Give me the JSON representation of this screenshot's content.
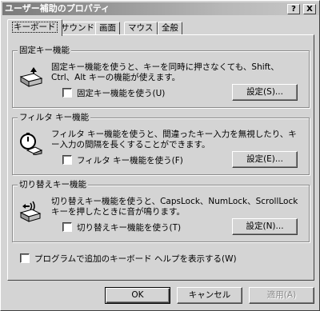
{
  "window": {
    "title": "ユーザー補助のプロパティ",
    "help_btn": "?",
    "close_btn": "X"
  },
  "tabs": [
    {
      "label": "キーボード",
      "active": true
    },
    {
      "label": "サウンド",
      "active": false
    },
    {
      "label": "画面",
      "active": false
    },
    {
      "label": "マウス",
      "active": false
    },
    {
      "label": "全般",
      "active": false
    }
  ],
  "groups": {
    "sticky": {
      "title": "固定キー機能",
      "desc": "固定キー機能を使うと、キーを同時に押さなくても、Shift、Ctrl、Alt キーの機能が使えます。",
      "check_label": "固定キー機能を使う(U)",
      "settings_label": "設定(S)...",
      "icon": "sticky-keys-icon"
    },
    "filter": {
      "title": "フィルタ キー機能",
      "desc": "フィルタ キー機能を使うと、間違ったキー入力を無視したり、キー入力の間隔を長くすることができます。",
      "check_label": "フィルタ キー機能を使う(F)",
      "settings_label": "設定(E)...",
      "icon": "filter-keys-icon"
    },
    "toggle": {
      "title": "切り替えキー機能",
      "desc": "切り替えキー機能を使うと、CapsLock、NumLock、ScrollLock キーを押したときに音が鳴ります。",
      "check_label": "切り替えキー機能を使う(T)",
      "settings_label": "設定(N)...",
      "icon": "toggle-keys-icon"
    }
  },
  "bottom_check_label": "プログラムで追加のキーボード ヘルプを表示する(W)",
  "buttons": {
    "ok": "OK",
    "cancel": "キャンセル",
    "apply": "適用(A)"
  }
}
